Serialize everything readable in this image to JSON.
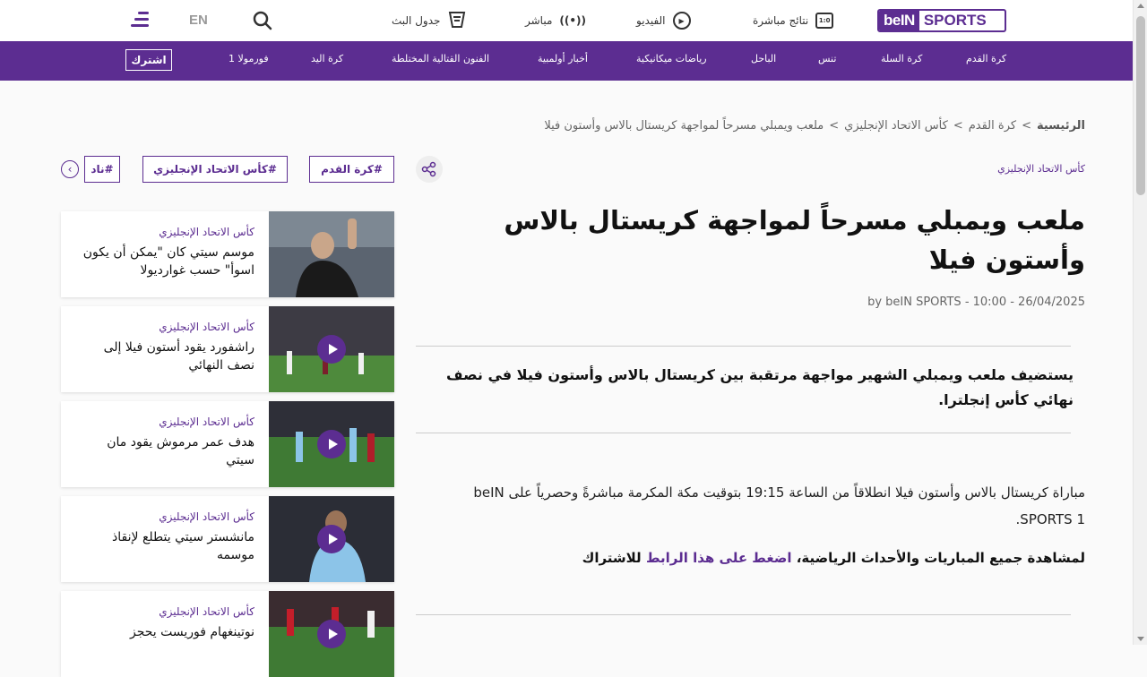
{
  "header": {
    "logo_text_1": "beIN",
    "logo_text_2": "SPORTS",
    "live_results_label": "نتائج مباشرة",
    "live_results_icon": "1:0",
    "video_label": "الفيديو",
    "live_label": "مباشر",
    "schedule_label": "جدول البث",
    "lang_label": "EN"
  },
  "nav": {
    "items": [
      "كرة القدم",
      "كرة السلة",
      "تنس",
      "الباحل",
      "رياضات ميكانيكية",
      "أخبار أولمبية",
      "الفنون القتالية المختلطة",
      "كرة اليد",
      "فورمولا 1"
    ],
    "subscribe_label": "اشترك"
  },
  "breadcrumb": {
    "home": "الرئيسية",
    "level1": "كرة القدم",
    "level2": "كأس الاتحاد الإنجليزي",
    "current": "ملعب ويمبلي مسرحاً لمواجهة كريستال بالاس وأستون فيلا",
    "separator": ">"
  },
  "article": {
    "category": "كأس الاتحاد الإنجليزي",
    "tags": [
      "#كرة القدم",
      "#كأس الاتحاد الإنجليزي",
      "#ناد"
    ],
    "headline": "ملعب ويمبلي مسرحاً لمواجهة كريستال بالاس وأستون فيلا",
    "byline": "by beIN SPORTS - 10:00 - 26/04/2025",
    "lead": "يستضيف ملعب ويمبلي الشهير مواجهة مرتقبة بين كريستال بالاس وأستون فيلا في نصف نهائي كأس إنجلترا.",
    "paragraph": "مباراة كريستال بالاس وأستون فيلا انطلاقاً من الساعة 19:15 بتوقيت مكة المكرمة مباشرةً وحصرياً على beIN SPORTS 1.",
    "cta_prefix": "لمشاهدة جميع المباريات والأحداث الرياضية،",
    "cta_link": "اضغط على هذا الرابط",
    "cta_suffix": "للاشتراك"
  },
  "sidebar": {
    "cards": [
      {
        "category": "كأس الاتحاد الإنجليزي",
        "title": "موسم سيتي كان \"يمكن أن يكون اسوأ\" حسب غوارديولا",
        "video": false
      },
      {
        "category": "كأس الاتحاد الإنجليزي",
        "title": "راشفورد يقود أستون فيلا إلى نصف النهائي",
        "video": true
      },
      {
        "category": "كأس الاتحاد الإنجليزي",
        "title": "هدف عمر مرموش يقود مان سيتي",
        "video": true
      },
      {
        "category": "كأس الاتحاد الإنجليزي",
        "title": "مانشستر سيتي يتطلع لإنقاذ موسمه",
        "video": true
      },
      {
        "category": "كأس الاتحاد الإنجليزي",
        "title": "نوتينغهام فوريست يحجز",
        "video": true
      }
    ]
  },
  "colors": {
    "brand": "#5c2d91",
    "text": "#111111"
  }
}
